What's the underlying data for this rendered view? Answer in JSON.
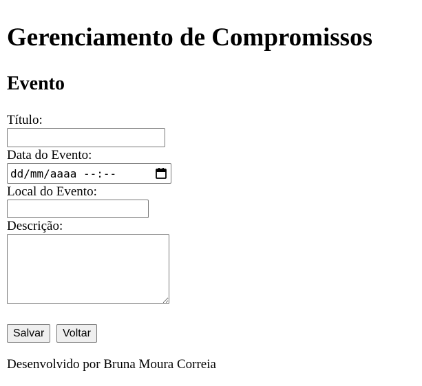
{
  "header": {
    "title": "Gerenciamento de Compromissos",
    "subtitle": "Evento"
  },
  "form": {
    "titulo_label": "Título:",
    "titulo_value": "",
    "data_label": "Data do Evento:",
    "data_value": "dd/mm/aaaa --:--",
    "local_label": "Local do Evento:",
    "local_value": "",
    "descricao_label": "Descrição:",
    "descricao_value": ""
  },
  "actions": {
    "save_label": "Salvar",
    "back_label": "Voltar"
  },
  "footer": {
    "text": "Desenvolvido por Bruna Moura Correia"
  },
  "icons": {
    "datetime_picker": "calendar-icon"
  }
}
